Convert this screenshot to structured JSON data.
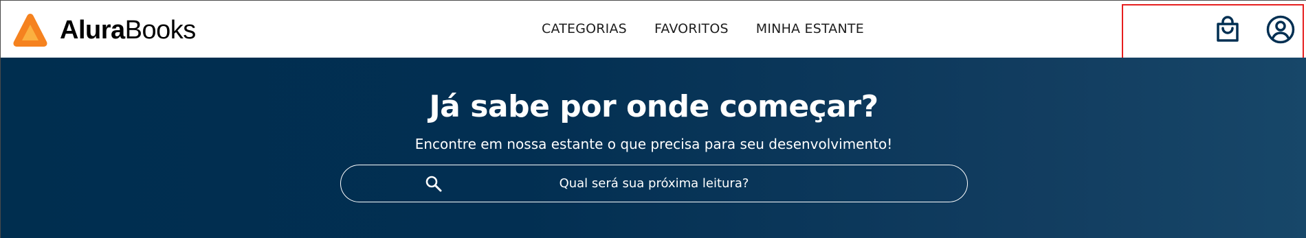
{
  "brand": {
    "name_bold": "Alura",
    "name_light": "Books",
    "logo_colors": {
      "outer": "#f5821f",
      "inner": "#fbb040"
    }
  },
  "nav": {
    "items": [
      {
        "label": "CATEGORIAS"
      },
      {
        "label": "FAVORITOS"
      },
      {
        "label": "MINHA ESTANTE"
      }
    ]
  },
  "header_actions": {
    "bag_icon": "shopping-bag-icon",
    "user_icon": "user-circle-icon",
    "icon_color": "#002f52",
    "highlight_color": "#e61e1e"
  },
  "hero": {
    "title": "Já sabe por onde começar?",
    "subtitle": "Encontre em nossa estante o que precisa para seu desenvolvimento!",
    "background_colors": [
      "#002e4f",
      "#174769"
    ]
  },
  "search": {
    "placeholder": "Qual será sua próxima leitura?",
    "value": "",
    "icon": "search-icon"
  }
}
